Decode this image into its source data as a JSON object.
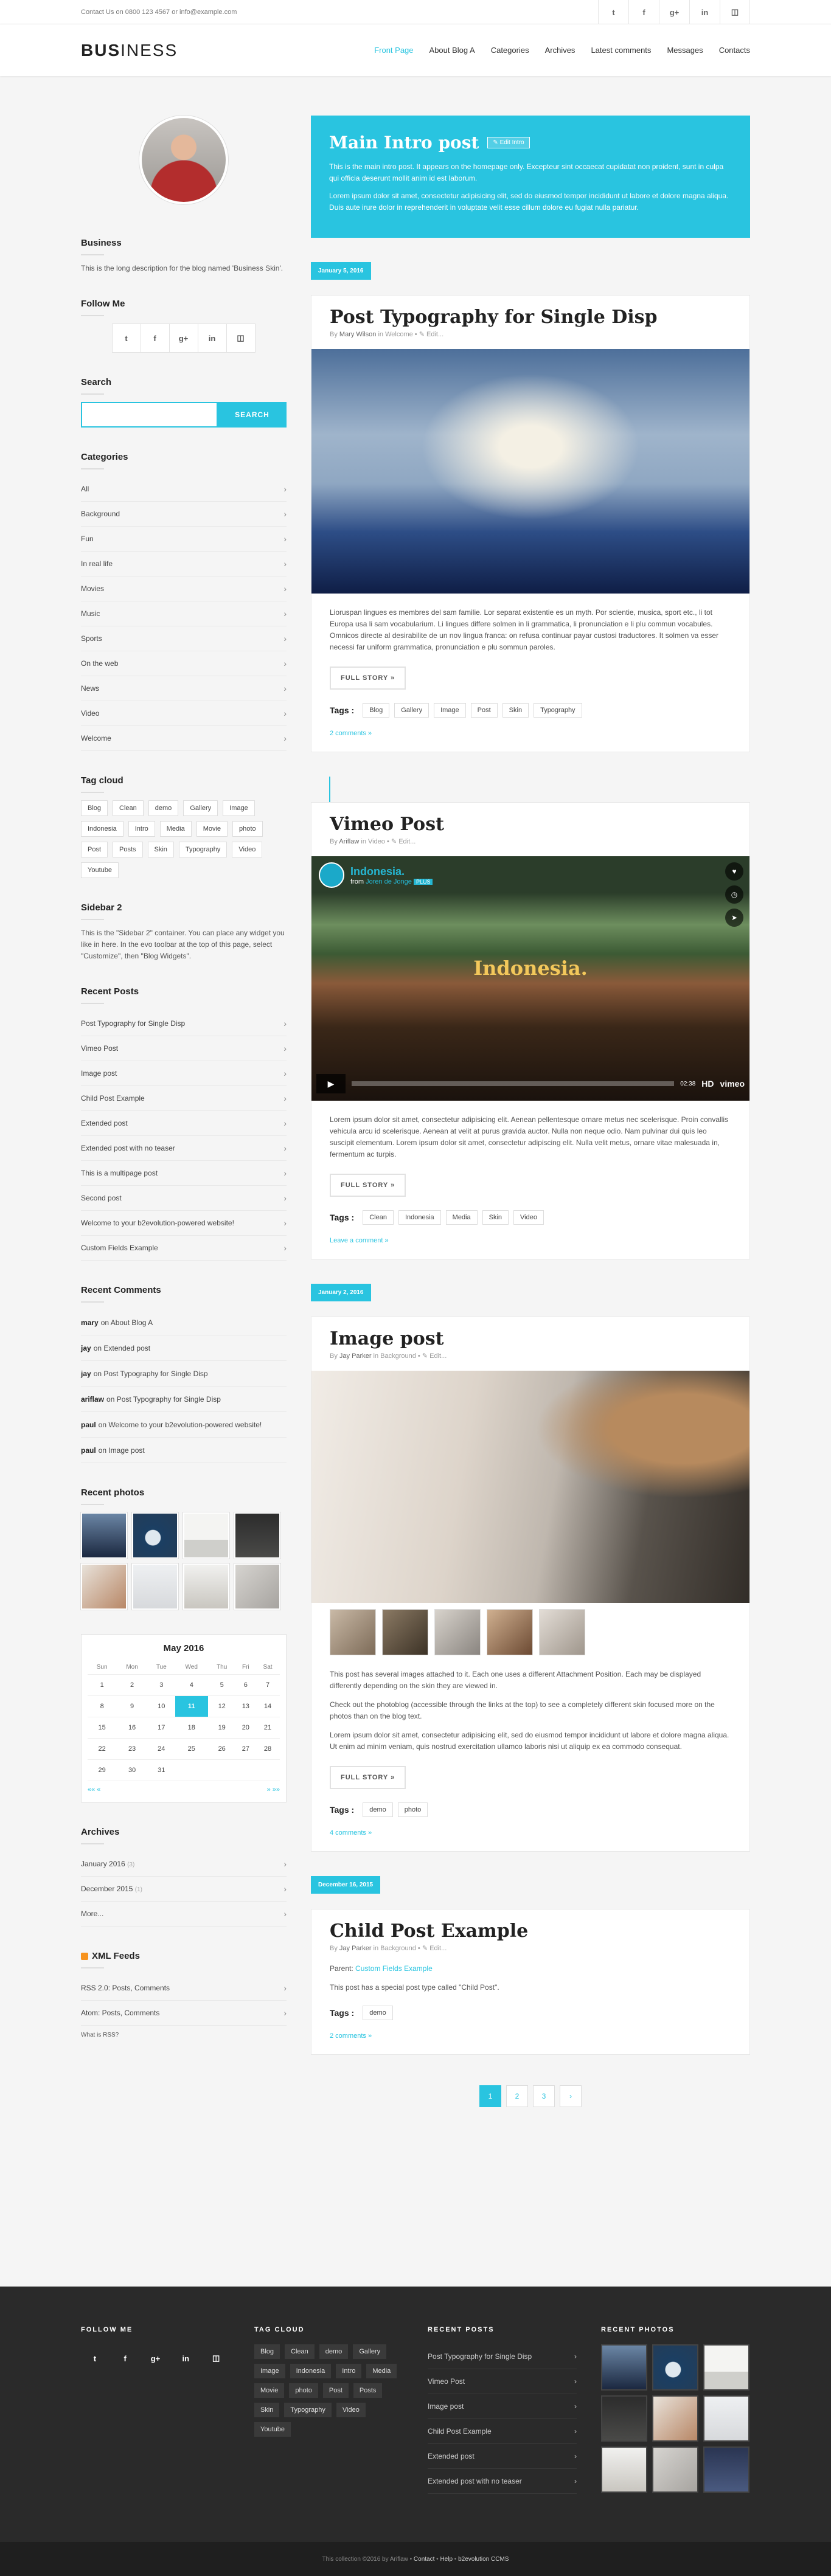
{
  "topbar": {
    "contact": "Contact Us on 0800 123 4567 or info@example.com",
    "social_icons": [
      "twitter-icon",
      "facebook-icon",
      "google-plus-icon",
      "linkedin-icon",
      "github-icon"
    ]
  },
  "header": {
    "logo_bold": "BUS",
    "logo_rest": "INESS",
    "nav": [
      {
        "label": "Front Page",
        "active": true
      },
      {
        "label": "About Blog A"
      },
      {
        "label": "Categories"
      },
      {
        "label": "Archives"
      },
      {
        "label": "Latest comments"
      },
      {
        "label": "Messages"
      },
      {
        "label": "Contacts"
      }
    ]
  },
  "sidebar": {
    "about": {
      "title": "Business",
      "text": "This is the long description for the blog named 'Business Skin'."
    },
    "follow": {
      "title": "Follow Me"
    },
    "search": {
      "title": "Search",
      "button": "SEARCH",
      "placeholder": ""
    },
    "categories": {
      "title": "Categories",
      "items": [
        "All",
        "Background",
        "Fun",
        "In real life",
        "Movies",
        "Music",
        "Sports",
        "On the web",
        "News",
        "Video",
        "Welcome"
      ]
    },
    "tagcloud": {
      "title": "Tag cloud",
      "tags": [
        "Blog",
        "Clean",
        "demo",
        "Gallery",
        "Image",
        "Indonesia",
        "Intro",
        "Media",
        "Movie",
        "photo",
        "Post",
        "Posts",
        "Skin",
        "Typography",
        "Video",
        "Youtube"
      ]
    },
    "sidebar2": {
      "title": "Sidebar 2",
      "text": "This is the \"Sidebar 2\" container. You can place any widget you like in here. In the evo toolbar at the top of this page, select \"Customize\", then \"Blog Widgets\"."
    },
    "recent_posts": {
      "title": "Recent Posts",
      "items": [
        "Post Typography for Single Disp",
        "Vimeo Post",
        "Image post",
        "Child Post Example",
        "Extended post",
        "Extended post with no teaser",
        "This is a multipage post",
        "Second post",
        "Welcome to your b2evolution-powered website!",
        "Custom Fields Example"
      ]
    },
    "recent_comments": {
      "title": "Recent Comments",
      "items": [
        {
          "author": "mary",
          "on": "on About Blog A"
        },
        {
          "author": "jay",
          "on": "on Extended post"
        },
        {
          "author": "jay",
          "on": "on Post Typography for Single Disp"
        },
        {
          "author": "ariflaw",
          "on": "on Post Typography for Single Disp"
        },
        {
          "author": "paul",
          "on": "on Welcome to your b2evolution-powered website!"
        },
        {
          "author": "paul",
          "on": "on Image post"
        }
      ]
    },
    "recent_photos": {
      "title": "Recent photos"
    },
    "calendar": {
      "title": "May 2016",
      "days": [
        "Sun",
        "Mon",
        "Tue",
        "Wed",
        "Thu",
        "Fri",
        "Sat"
      ],
      "weeks": [
        [
          "1",
          "2",
          "3",
          "4",
          "5",
          "6",
          "7"
        ],
        [
          "8",
          "9",
          "10",
          "11",
          "12",
          "13",
          "14"
        ],
        [
          "15",
          "16",
          "17",
          "18",
          "19",
          "20",
          "21"
        ],
        [
          "22",
          "23",
          "24",
          "25",
          "26",
          "27",
          "28"
        ],
        [
          "29",
          "30",
          "31",
          "",
          "",
          "",
          ""
        ]
      ],
      "today": "11",
      "nav_prev": "«« «",
      "nav_next": "» »»"
    },
    "archives": {
      "title": "Archives",
      "items": [
        {
          "label": "January 2016",
          "count": "(3)"
        },
        {
          "label": "December 2015",
          "count": "(1)"
        },
        {
          "label": "More...",
          "count": ""
        }
      ]
    },
    "xml": {
      "title": "XML Feeds",
      "items": [
        "RSS 2.0: Posts, Comments",
        "Atom: Posts, Comments"
      ],
      "what": "What is RSS?"
    }
  },
  "intro": {
    "title": "Main Intro post",
    "edit": "Edit Intro",
    "p1": "This is the main intro post. It appears on the homepage only. Excepteur sint occaecat cupidatat non proident, sunt in culpa qui officia deserunt mollit anim id est laborum.",
    "p2": "Lorem ipsum dolor sit amet, consectetur adipisicing elit, sed do eiusmod tempor incididunt ut labore et dolore magna aliqua. Duis aute irure dolor in reprehenderit in voluptate velit esse cillum dolore eu fugiat nulla pariatur."
  },
  "posts": [
    {
      "date": "January 5, 2016",
      "title": "Post Typography for Single Disp",
      "meta_by": "By",
      "author": "Mary Wilson",
      "meta_in": "in Welcome",
      "edit": "Edit...",
      "body": "Lioruspan lingues es membres del sam familie. Lor separat existentie es un myth. Por scientie, musica, sport etc., li tot Europa usa li sam vocabularium. Li lingues differe solmen in li grammatica, li pronunciation e li plu commun vocabules. Omnicos directe al desirabilite de un nov lingua franca: on refusa continuar payar custosi traductores. It solmen va esser necessi far uniform grammatica, pronunciation e plu sommun paroles.",
      "full": "FULL STORY »",
      "tags_label": "Tags :",
      "tags": [
        "Blog",
        "Gallery",
        "Image",
        "Post",
        "Skin",
        "Typography"
      ],
      "comments": "2 comments »"
    },
    {
      "title": "Vimeo Post",
      "meta_by": "By",
      "author": "Ariflaw",
      "meta_in": "in Video",
      "edit": "Edit...",
      "video_title": "Indonesia.",
      "video_from": "from",
      "video_channel": "Joren de Jonge",
      "video_plus": "PLUS",
      "video_big": "Indonesia.",
      "video_time": "02:38",
      "video_hd": "HD",
      "video_logo": "vimeo",
      "body": "Lorem ipsum dolor sit amet, consectetur adipisicing elit. Aenean pellentesque ornare metus nec scelerisque. Proin convallis vehicula arcu id scelerisque. Aenean at velit at purus gravida auctor. Nulla non neque odio. Nam pulvinar dui quis leo suscipit elementum. Lorem ipsum dolor sit amet, consectetur adipiscing elit. Nulla velit metus, ornare vitae malesuada in, fermentum ac turpis.",
      "full": "FULL STORY »",
      "tags_label": "Tags :",
      "tags": [
        "Clean",
        "Indonesia",
        "Media",
        "Skin",
        "Video"
      ],
      "comments": "Leave a comment »"
    },
    {
      "date": "January 2, 2016",
      "title": "Image post",
      "meta_by": "By",
      "author": "Jay Parker",
      "meta_in": "in Background",
      "edit": "Edit...",
      "p1": "This post has several images attached to it. Each one uses a different Attachment Position. Each may be displayed differently depending on the skin they are viewed in.",
      "p2": "Check out the photoblog (accessible through the links at the top) to see a completely different skin focused more on the photos than on the blog text.",
      "p3": "Lorem ipsum dolor sit amet, consectetur adipisicing elit, sed do eiusmod tempor incididunt ut labore et dolore magna aliqua. Ut enim ad minim veniam, quis nostrud exercitation ullamco laboris nisi ut aliquip ex ea commodo consequat.",
      "full": "FULL STORY »",
      "tags_label": "Tags :",
      "tags": [
        "demo",
        "photo"
      ],
      "comments": "4 comments »"
    },
    {
      "date": "December 16, 2015",
      "title": "Child Post Example",
      "meta_by": "By",
      "author": "Jay Parker",
      "meta_in": "in Background",
      "edit": "Edit...",
      "parent_label": "Parent:",
      "parent_link": "Custom Fields Example",
      "p1": "This post has a special post type called \"Child Post\".",
      "tags_label": "Tags :",
      "tags": [
        "demo"
      ],
      "comments": "2 comments »"
    }
  ],
  "pager": [
    "1",
    "2",
    "3",
    "›"
  ],
  "footer": {
    "follow_title": "FOLLOW ME",
    "tag_title": "TAG CLOUD",
    "tags": [
      "Blog",
      "Clean",
      "demo",
      "Gallery",
      "Image",
      "Indonesia",
      "Intro",
      "Media",
      "Movie",
      "photo",
      "Post",
      "Posts",
      "Skin",
      "Typography",
      "Video",
      "Youtube"
    ],
    "posts_title": "RECENT POSTS",
    "posts": [
      "Post Typography for Single Disp",
      "Vimeo Post",
      "Image post",
      "Child Post Example",
      "Extended post",
      "Extended post with no teaser"
    ],
    "photos_title": "RECENT PHOTOS"
  },
  "bottom": {
    "pre": "This collection ©2016 by Ariflaw •",
    "contact": "Contact",
    "help": "Help",
    "engine": "b2evolution CCMS"
  }
}
